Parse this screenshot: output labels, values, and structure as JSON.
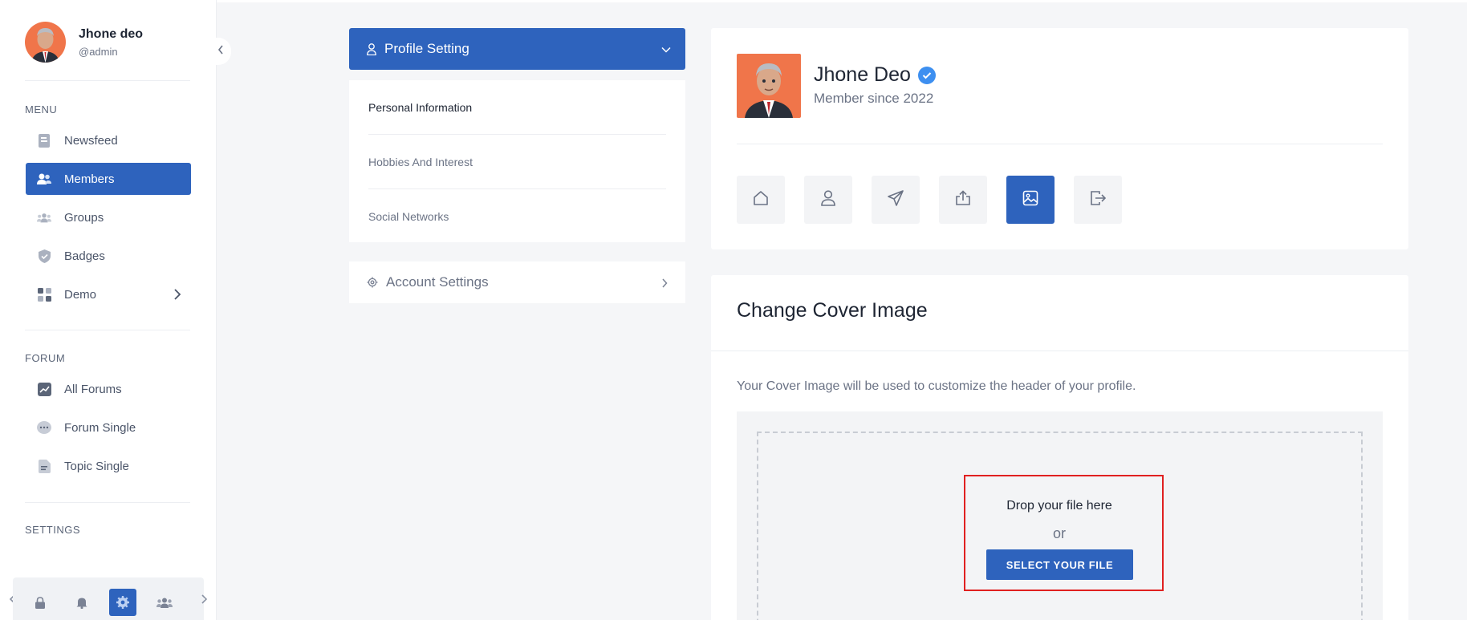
{
  "user": {
    "name": "Jhone deo",
    "handle": "@admin"
  },
  "sidebar": {
    "menu_label": "MENU",
    "menu_items": [
      {
        "label": "Newsfeed",
        "icon": "newsfeed-icon"
      },
      {
        "label": "Members",
        "icon": "members-icon",
        "active": true
      },
      {
        "label": "Groups",
        "icon": "groups-icon"
      },
      {
        "label": "Badges",
        "icon": "badge-icon"
      },
      {
        "label": "Demo",
        "icon": "grid-icon",
        "has_submenu": true
      }
    ],
    "forum_label": "FORUM",
    "forum_items": [
      {
        "label": "All Forums",
        "icon": "chart-icon"
      },
      {
        "label": "Forum Single",
        "icon": "chat-icon"
      },
      {
        "label": "Topic Single",
        "icon": "document-icon"
      }
    ],
    "settings_label": "SETTINGS",
    "bottom_icons": [
      "lock-icon",
      "bell-icon",
      "gear-icon",
      "users-icon"
    ]
  },
  "settings_menu": {
    "profile_setting": "Profile Setting",
    "items": [
      "Personal Information",
      "Hobbies And Interest",
      "Social Networks"
    ],
    "account_settings": "Account Settings"
  },
  "profile": {
    "name": "Jhone Deo",
    "since": "Member since 2022",
    "tabs": [
      "home-icon",
      "user-icon",
      "send-icon",
      "upload-icon",
      "image-icon",
      "logout-icon"
    ],
    "active_tab": 4
  },
  "cover": {
    "title": "Change Cover Image",
    "description": "Your Cover Image will be used to customize the header of your profile.",
    "drop_text": "Drop your file here",
    "or": "or",
    "button": "SELECT YOUR FILE"
  },
  "colors": {
    "primary": "#2e63bd",
    "verified": "#3d8ff0",
    "highlight": "#e02020"
  }
}
